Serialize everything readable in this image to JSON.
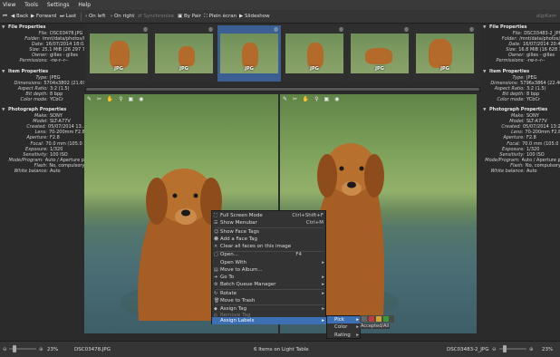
{
  "menubar": {
    "items": [
      "View",
      "Tools",
      "Settings",
      "Help"
    ]
  },
  "toolbar": {
    "back": "Back",
    "forward": "Forward",
    "last": "Last",
    "on_left": "On left",
    "on_right": "On right",
    "synchronize": "Synchronize",
    "by_pair": "By Pair",
    "fullscreen": "Plein écran",
    "slideshow": "Slideshow",
    "brand": "digiKam"
  },
  "left_props": {
    "file_title": "File Properties",
    "file": [
      {
        "k": "File:",
        "v": "DSC03478.JPG"
      },
      {
        "k": "Folder:",
        "v": "/mnt/data/photos/Gi..."
      },
      {
        "k": "Date:",
        "v": "16/07/2014 18:0..."
      },
      {
        "k": "Size:",
        "v": "25.1 MiB (26 297 737)"
      },
      {
        "k": "Owner:",
        "v": "gilles - gilles"
      },
      {
        "k": "Permissions:",
        "v": "-rw-r--r--"
      }
    ],
    "item_title": "Item Properties",
    "item": [
      {
        "k": "Type:",
        "v": "JPEG"
      },
      {
        "k": "Dimensions:",
        "v": "5704x3802 (21.69..."
      },
      {
        "k": "Aspect Ratio:",
        "v": "3:2 (1.5)"
      },
      {
        "k": "Bit depth:",
        "v": "8 bpp"
      },
      {
        "k": "Color mode:",
        "v": "YCbCr"
      }
    ],
    "photo_title": "Photograph Properties",
    "photo": [
      {
        "k": "Make:",
        "v": "SONY"
      },
      {
        "k": "Model:",
        "v": "SLT-A77V"
      },
      {
        "k": "Created:",
        "v": "05/07/2014 13..."
      },
      {
        "k": "Lens:",
        "v": "70-200mm F2.8"
      },
      {
        "k": "Aperture:",
        "v": "F2.8"
      },
      {
        "k": "Focal:",
        "v": "70.0 mm (105.0 ..."
      },
      {
        "k": "Exposure:",
        "v": "1/320"
      },
      {
        "k": "Sensitivity:",
        "v": "100 ISO"
      },
      {
        "k": "Mode/Program:",
        "v": "Auto / Aperture p..."
      },
      {
        "k": "Flash:",
        "v": "No, compulsory"
      },
      {
        "k": "White balance:",
        "v": "Auto"
      }
    ]
  },
  "right_props": {
    "file_title": "File Properties",
    "file": [
      {
        "k": "File:",
        "v": "DSC03483-2_JPG"
      },
      {
        "k": "Folder:",
        "v": "/mnt/data/photos/G..."
      },
      {
        "k": "Date:",
        "v": "16/07/2014 20:40"
      },
      {
        "k": "Size:",
        "v": "16.8 MiB (16 628 142)"
      },
      {
        "k": "Owner:",
        "v": "gilles - gilles"
      },
      {
        "k": "Permissions:",
        "v": "-rw-r--r--"
      }
    ],
    "item_title": "Item Properties",
    "item": [
      {
        "k": "Type:",
        "v": "JPEG"
      },
      {
        "k": "Dimensions:",
        "v": "5796x3864 (22.40..."
      },
      {
        "k": "Aspect Ratio:",
        "v": "3:2 (1.5)"
      },
      {
        "k": "Bit depth:",
        "v": "8 bpp"
      },
      {
        "k": "Color mode:",
        "v": "YCbCr"
      }
    ],
    "photo_title": "Photograph Properties",
    "photo": [
      {
        "k": "Make:",
        "v": "SONY"
      },
      {
        "k": "Model:",
        "v": "SLT-A77V"
      },
      {
        "k": "Created:",
        "v": "05/07/2014 13:26"
      },
      {
        "k": "Lens:",
        "v": "70-200mm F2.8"
      },
      {
        "k": "Aperture:",
        "v": "F2.8"
      },
      {
        "k": "Focal:",
        "v": "70.0 mm (105.0 ..."
      },
      {
        "k": "Exposure:",
        "v": "1/320"
      },
      {
        "k": "Sensitivity:",
        "v": "100 ISO"
      },
      {
        "k": "Mode/Program:",
        "v": "Auto / Aperture p..."
      },
      {
        "k": "Flash:",
        "v": "No, compulsory"
      },
      {
        "k": "White balance:",
        "v": "Auto"
      }
    ]
  },
  "filmstrip": {
    "labels": [
      "JPG",
      "JPG",
      "JPG",
      "JPG",
      "JPG",
      "JPG"
    ],
    "selected_index": 2
  },
  "context_menu": {
    "items": [
      {
        "label": "Full Screen Mode",
        "shortcut": "Ctrl+Shift+F",
        "icon": "fullscreen-icon"
      },
      {
        "label": "Show Menubar",
        "shortcut": "Ctrl+M",
        "icon": "menubar-icon"
      },
      {
        "label": "Show Face Tags",
        "shortcut": "",
        "icon": "face-icon"
      },
      {
        "label": "Add a Face Tag",
        "shortcut": "",
        "icon": "face-add-icon"
      },
      {
        "label": "Clear all faces on this image",
        "shortcut": "",
        "icon": "clear-icon"
      },
      {
        "label": "Open...",
        "shortcut": "F4",
        "icon": "open-icon"
      },
      {
        "label": "Open With",
        "shortcut": "",
        "icon": "",
        "submenu": true
      },
      {
        "label": "Move to Album...",
        "shortcut": "",
        "icon": "album-icon"
      },
      {
        "label": "Go To",
        "shortcut": "",
        "icon": "goto-icon",
        "submenu": true
      },
      {
        "label": "Batch Queue Manager",
        "shortcut": "",
        "icon": "batch-icon",
        "submenu": true
      },
      {
        "label": "Rotate",
        "shortcut": "",
        "icon": "rotate-icon",
        "submenu": true
      },
      {
        "label": "Move to Trash",
        "shortcut": "",
        "icon": "trash-icon"
      },
      {
        "label": "Assign Tag",
        "shortcut": "",
        "icon": "tag-icon",
        "submenu": true
      },
      {
        "label": "Remove Tag",
        "shortcut": "",
        "icon": "tag-remove-icon",
        "disabled": true
      },
      {
        "label": "Assign Labels",
        "shortcut": "",
        "icon": "",
        "submenu": true,
        "highlighted": true
      }
    ],
    "submenu": [
      "Pick",
      "Color",
      "Rating"
    ],
    "accepted_label": "Accepted/All"
  },
  "statusbar": {
    "left_file": "DSC03478.JPG",
    "left_zoom": "23%",
    "center": "6 Items on Light Table",
    "right_file": "DSC03483-2_JPG",
    "right_zoom": "23%"
  },
  "colors": {
    "selection": "#3d6fb4",
    "panel": "#2b2b2b",
    "accent_thumb": "#3b5f92"
  }
}
